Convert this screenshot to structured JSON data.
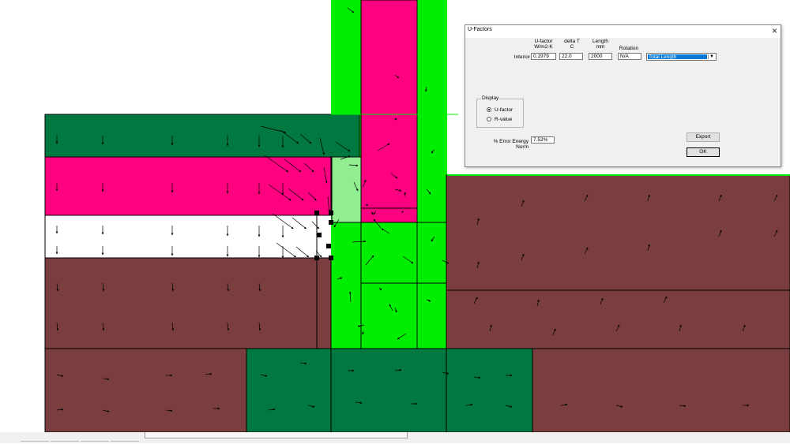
{
  "dialog": {
    "title": "U-Factors",
    "close_glyph": "×",
    "headers": {
      "ufactor": "U-factor",
      "ufactor_unit": "W/m2-K",
      "deltat": "delta T",
      "deltat_unit": "C",
      "length": "Length",
      "length_unit": "mm",
      "rotation": "Rotation"
    },
    "row": {
      "label": "Interior",
      "ufactor": "0.1979",
      "deltat": "22.0",
      "length": "2000",
      "rotation": "N/A",
      "length_option": "Total Length"
    },
    "display": {
      "title": "Display",
      "options": [
        "U-factor",
        "R-value"
      ],
      "selected": "U-factor"
    },
    "error": {
      "label": "% Error Energy Norm",
      "value": "7.52%"
    },
    "buttons": {
      "export": "Export",
      "ok": "OK"
    }
  },
  "colors": {
    "bright_green": "#00ee00",
    "light_green": "#90ee90",
    "magenta": "#ff0080",
    "dark_green": "#007840",
    "brown": "#7a3e3e",
    "white": "#ffffff",
    "outline": "#000000"
  },
  "icons": {
    "close": "close-icon",
    "dropdown": "chevron-down-icon",
    "heat_flux": "arrow-icon"
  }
}
